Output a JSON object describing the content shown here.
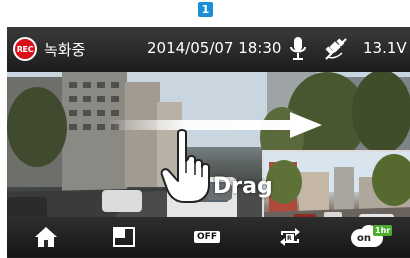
{
  "callout": {
    "number": "1",
    "color": "#1a8fd6"
  },
  "status_bar": {
    "rec_badge": "REC",
    "rec_status": "녹화중",
    "datetime": "2014/05/07 18:30",
    "voltage": "13.1V",
    "mic_icon": "microphone-icon",
    "gps_icon": "gps-off-icon"
  },
  "overlay": {
    "gesture_label": "Drag",
    "gesture_icon": "hand-pointer-icon",
    "arrow_icon": "swipe-right-arrow-icon"
  },
  "toolbar": {
    "home_icon": "home-icon",
    "pip_icon": "picture-in-picture-icon",
    "off_label": "OFF",
    "rotate_icon": "camera-switch-icon",
    "on_label": "on",
    "hr_badge": "1hr"
  },
  "colors": {
    "rec_red": "#d8101b",
    "accent_blue": "#1a8fd6",
    "badge_green": "#4cae2f"
  }
}
